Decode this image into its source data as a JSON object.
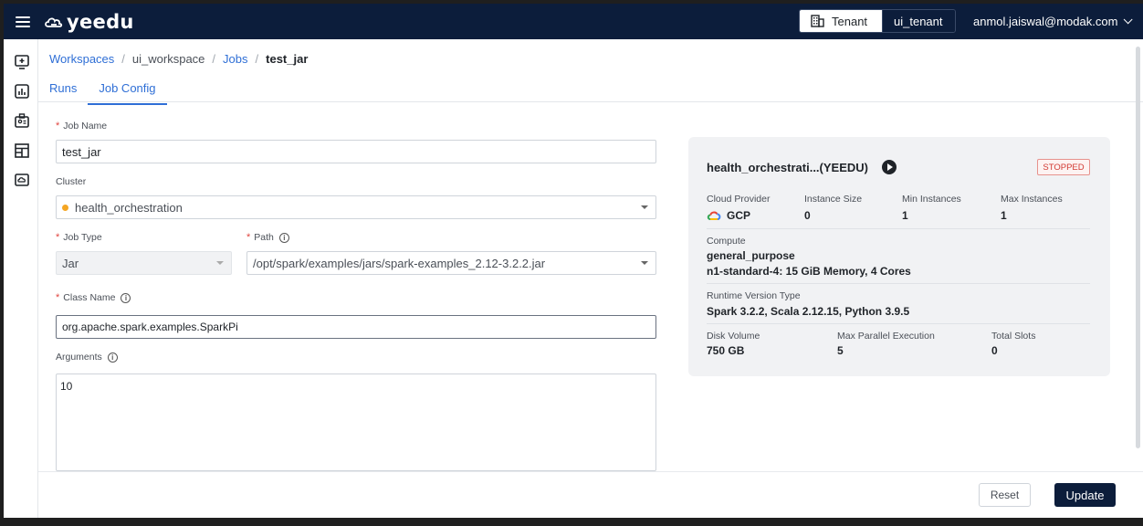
{
  "header": {
    "brand": "yeedu",
    "tenant_label": "Tenant",
    "tenant_value": "ui_tenant",
    "user_email": "anmol.jaiswal@modak.com"
  },
  "sidebar": {
    "icons": [
      "add-monitor-icon",
      "bar-chart-icon",
      "id-badge-icon",
      "layout-icon",
      "cloud-monitor-icon"
    ]
  },
  "breadcrumb": {
    "items": [
      "Workspaces",
      "ui_workspace",
      "Jobs"
    ],
    "current": "test_jar"
  },
  "tabs": [
    "Runs",
    "Job Config"
  ],
  "active_tab": "Job Config",
  "form": {
    "job_name": {
      "label": "Job Name",
      "value": "test_jar"
    },
    "cluster": {
      "label": "Cluster",
      "value": "health_orchestration",
      "status_color": "#f5a623"
    },
    "job_type": {
      "label": "Job Type",
      "value": "Jar"
    },
    "path": {
      "label": "Path",
      "value": "/opt/spark/examples/jars/spark-examples_2.12-3.2.2.jar"
    },
    "class_name": {
      "label": "Class Name",
      "value": "org.apache.spark.examples.SparkPi"
    },
    "arguments": {
      "label": "Arguments",
      "value": "10"
    }
  },
  "cluster_card": {
    "title": "health_orchestrati...(YEEDU)",
    "status": "STOPPED",
    "cloud_provider_label": "Cloud Provider",
    "cloud_provider_value": "GCP",
    "instance_size_label": "Instance Size",
    "instance_size_value": "0",
    "min_instances_label": "Min Instances",
    "min_instances_value": "1",
    "max_instances_label": "Max Instances",
    "max_instances_value": "1",
    "compute_label": "Compute",
    "compute_value": "general_purpose",
    "compute_detail": "n1-standard-4:  15 GiB Memory,  4 Cores",
    "runtime_label": "Runtime Version Type",
    "runtime_value": "Spark 3.2.2, Scala 2.12.15, Python 3.9.5",
    "disk_label": "Disk Volume",
    "disk_value": "750 GB",
    "max_parallel_label": "Max Parallel Execution",
    "max_parallel_value": "5",
    "total_slots_label": "Total Slots",
    "total_slots_value": "0"
  },
  "actions": {
    "reset": "Reset",
    "update": "Update"
  },
  "colors": {
    "header_bg": "#0c1d3b",
    "link": "#2f6fd6",
    "required": "#e0453f",
    "stopped": "#d23a33"
  }
}
